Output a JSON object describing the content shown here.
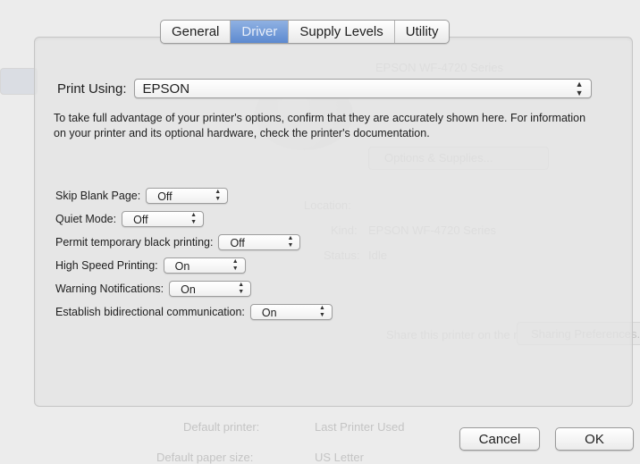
{
  "tabs": [
    {
      "label": "General",
      "active": false
    },
    {
      "label": "Driver",
      "active": true
    },
    {
      "label": "Supply Levels",
      "active": false
    },
    {
      "label": "Utility",
      "active": false
    }
  ],
  "print_using": {
    "label": "Print Using:",
    "value": "EPSON"
  },
  "description": "To take full advantage of your printer's options, confirm that they are accurately shown here. For information on your printer and its optional hardware, check the printer's documentation.",
  "settings": [
    {
      "label": "Skip Blank Page:",
      "value": "Off"
    },
    {
      "label": "Quiet Mode:",
      "value": "Off"
    },
    {
      "label": "Permit temporary black printing:",
      "value": "Off"
    },
    {
      "label": "High Speed Printing:",
      "value": "On"
    },
    {
      "label": "Warning Notifications:",
      "value": "On"
    },
    {
      "label": "Establish bidirectional communication:",
      "value": "On"
    }
  ],
  "buttons": {
    "cancel": "Cancel",
    "ok": "OK"
  },
  "background_window": {
    "printer_name": "EPSON WF-4720 Series",
    "options_button": "Options & Supplies...",
    "location_label": "Location:",
    "kind_label": "Kind:",
    "kind_value": "EPSON WF-4720 Series",
    "status_label": "Status:",
    "status_value": "Idle",
    "share_label": "Share this printer on the network",
    "sharing_button": "Sharing Preferences...",
    "default_printer_label": "Default printer:",
    "default_printer_value": "Last Printer Used",
    "paper_size_label": "Default paper size:",
    "paper_size_value": "US Letter"
  },
  "colors": {
    "tab_active_top": "#8fb1e2",
    "tab_active_bottom": "#5d8ad0",
    "background": "#ececec"
  }
}
